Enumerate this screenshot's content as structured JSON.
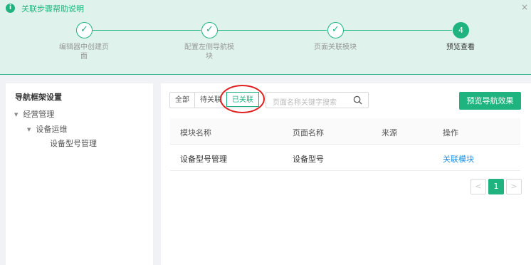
{
  "banner": {
    "info_icon": "info-icon",
    "title": "关联步骤帮助说明",
    "close": "×",
    "steps": [
      {
        "marker": "✓",
        "label_line1": "编辑器中创建页",
        "label_line2": "面"
      },
      {
        "marker": "✓",
        "label_line1": "配置左侧导航模",
        "label_line2": "块"
      },
      {
        "marker": "✓",
        "label_line1": "页面关联模块",
        "label_line2": ""
      },
      {
        "marker": "4",
        "label_line1": "预览查看",
        "label_line2": ""
      }
    ]
  },
  "sidebar": {
    "heading": "导航框架设置",
    "tree": [
      {
        "label": "经营管理",
        "level": 0,
        "expanded": true
      },
      {
        "label": "设备运维",
        "level": 1,
        "expanded": true
      },
      {
        "label": "设备型号管理",
        "level": 2,
        "expanded": false
      }
    ]
  },
  "main": {
    "tabs": [
      {
        "label": "全部",
        "active": false
      },
      {
        "label": "待关联",
        "active": false
      },
      {
        "label": "已关联",
        "active": true
      }
    ],
    "search_placeholder": "页面名称关键字搜索",
    "preview_button": "预览导航效果",
    "table": {
      "headers": [
        "模块名称",
        "页面名称",
        "来源",
        "操作"
      ],
      "rows": [
        {
          "module": "设备型号管理",
          "page": "设备型号",
          "source": "",
          "action": "关联模块"
        }
      ]
    },
    "pagination": {
      "prev": "<",
      "current": "1",
      "next": ">"
    }
  },
  "colors": {
    "accent": "#1fb37f",
    "banner_bg": "#dff3ec",
    "link": "#1f8fe0",
    "highlight": "#e02020"
  }
}
